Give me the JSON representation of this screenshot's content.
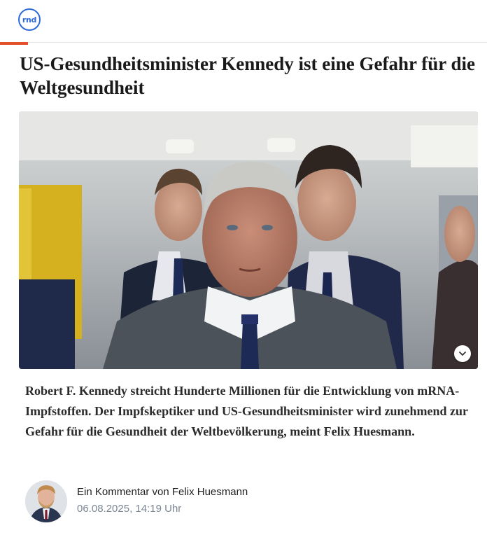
{
  "header": {
    "logo_text": "rnd",
    "brand_color": "#2d6ad8",
    "accent_color": "#e3512a"
  },
  "article": {
    "headline": "US-Gesundheitsminister Kennedy ist eine Gefahr für die Weltgesundheit",
    "teaser": "Robert F. Kennedy streicht Hunderte Millionen für die Entwicklung von mRNA-Impfstoffen. Der Impfskeptiker und US-Gesundheitsminister wird zunehmend zur Gefahr für die Gesundheit der Weltbevölkerung, meint Felix Huesmann.",
    "image_expand_icon": "chevron-down-icon"
  },
  "author": {
    "byline": "Ein Kommentar von Felix Huesmann",
    "date": "06.08.2025, 14:19 Uhr"
  }
}
